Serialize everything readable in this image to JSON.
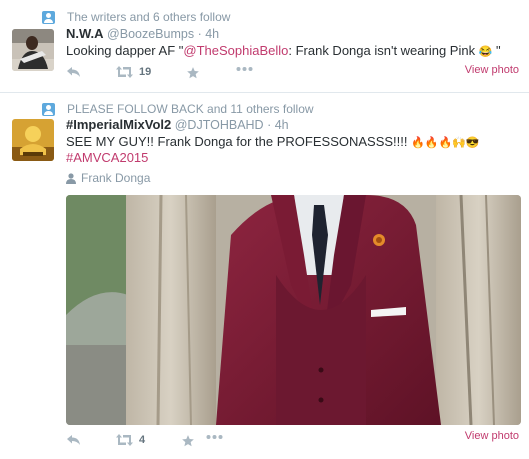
{
  "tweets": [
    {
      "context": "The writers and 6 others follow",
      "name": "N.W.A",
      "handle": "@BoozeBumps",
      "separator": "·",
      "time": "4h",
      "text_prefix": "Looking dapper AF \"",
      "mention": "@TheSophiaBello",
      "text_suffix": ": Frank Donga isn't wearing Pink",
      "emoji": "😂",
      "text_end": " \"",
      "retweet_count": "19",
      "view_photo": "View photo"
    },
    {
      "context": "PLEASE FOLLOW BACK and 11 others follow",
      "name": "#ImperialMixVol2",
      "handle": "@DJTOHBAHD",
      "separator": "·",
      "time": "4h",
      "text_line1": "SEE MY GUY!! Frank Donga for the PROFESSONASSS!!!!",
      "emojis": "🔥🔥🔥🙌😎",
      "hashtag": "#AMVCA2015",
      "tagged_user": "Frank Donga",
      "retweet_count": "4",
      "view_photo": "View photo"
    }
  ],
  "icons": {
    "context": "person-icon",
    "reply": "reply-icon",
    "retweet": "retweet-icon",
    "favorite": "star-icon",
    "more": "more-icon",
    "tag": "person-tag-icon"
  },
  "colors": {
    "link": "#c13b6e",
    "muted": "#8899a6",
    "action": "#aab8c2",
    "context_icon": "#5ea9dd",
    "text": "#292f33"
  }
}
